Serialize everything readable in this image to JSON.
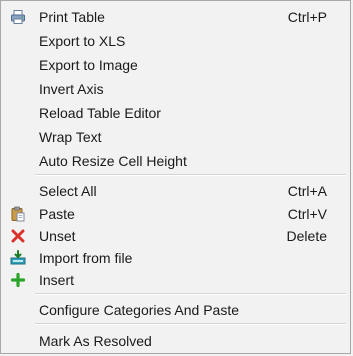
{
  "menu": {
    "items": [
      {
        "label": "Print Table",
        "shortcut": "Ctrl+P",
        "icon": "printer-icon"
      },
      {
        "label": "Export to XLS",
        "shortcut": "",
        "icon": ""
      },
      {
        "label": "Export to Image",
        "shortcut": "",
        "icon": ""
      },
      {
        "label": "Invert Axis",
        "shortcut": "",
        "icon": ""
      },
      {
        "label": "Reload Table Editor",
        "shortcut": "",
        "icon": ""
      },
      {
        "label": "Wrap Text",
        "shortcut": "",
        "icon": ""
      },
      {
        "label": "Auto Resize Cell Height",
        "shortcut": "",
        "icon": ""
      },
      {
        "label": "Select All",
        "shortcut": "Ctrl+A",
        "icon": ""
      },
      {
        "label": "Paste",
        "shortcut": "Ctrl+V",
        "icon": "clipboard-paste-icon"
      },
      {
        "label": "Unset",
        "shortcut": "Delete",
        "icon": "red-x-icon"
      },
      {
        "label": "Import from file",
        "shortcut": "",
        "icon": "import-file-icon"
      },
      {
        "label": "Insert",
        "shortcut": "",
        "icon": "green-plus-icon"
      },
      {
        "label": "Configure Categories And Paste",
        "shortcut": "",
        "icon": ""
      },
      {
        "label": "Mark As Resolved",
        "shortcut": "",
        "icon": ""
      }
    ]
  },
  "colors": {
    "background": "#f2f2f2",
    "border": "#a8a8a8",
    "text": "#1a1a1a",
    "unset_icon": "#d9312b",
    "insert_icon": "#2aa52a"
  }
}
